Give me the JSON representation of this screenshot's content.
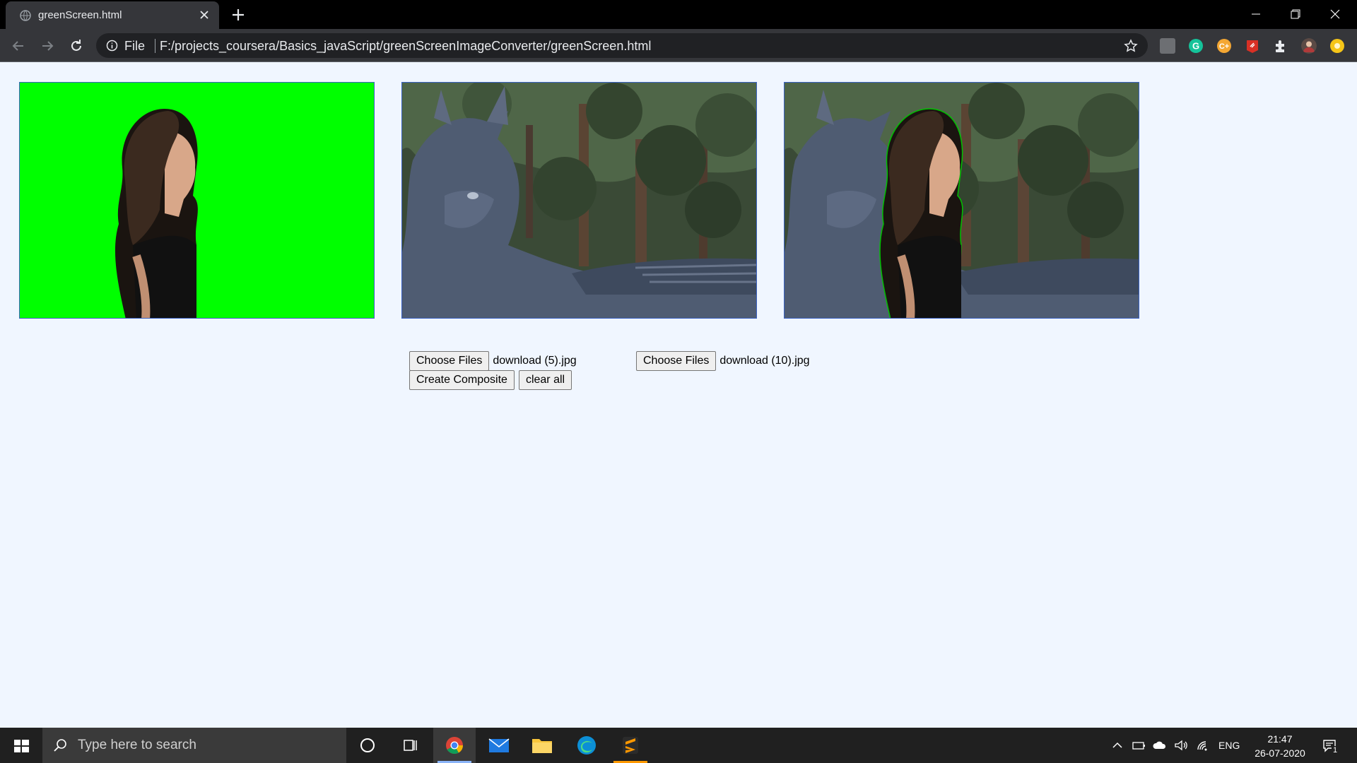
{
  "browser": {
    "tab_title": "greenScreen.html",
    "omnibox_scheme": "File",
    "url": "F:/projects_coursera/Basics_javaScript/greenScreenImageConverter/greenScreen.html"
  },
  "page": {
    "foreground_file_button": "Choose Files",
    "foreground_file_name": "download (5).jpg",
    "background_file_button": "Choose Files",
    "background_file_name": "download (10).jpg",
    "create_composite_button": "Create Composite",
    "clear_all_button": "clear all"
  },
  "taskbar": {
    "search_placeholder": "Type here to search",
    "language": "ENG",
    "time": "21:47",
    "date": "26-07-2020",
    "notification_count": "1"
  },
  "colors": {
    "page_bg": "#f0f6ff",
    "green_screen": "#00ff00",
    "canvas_border": "#3a62c4"
  }
}
